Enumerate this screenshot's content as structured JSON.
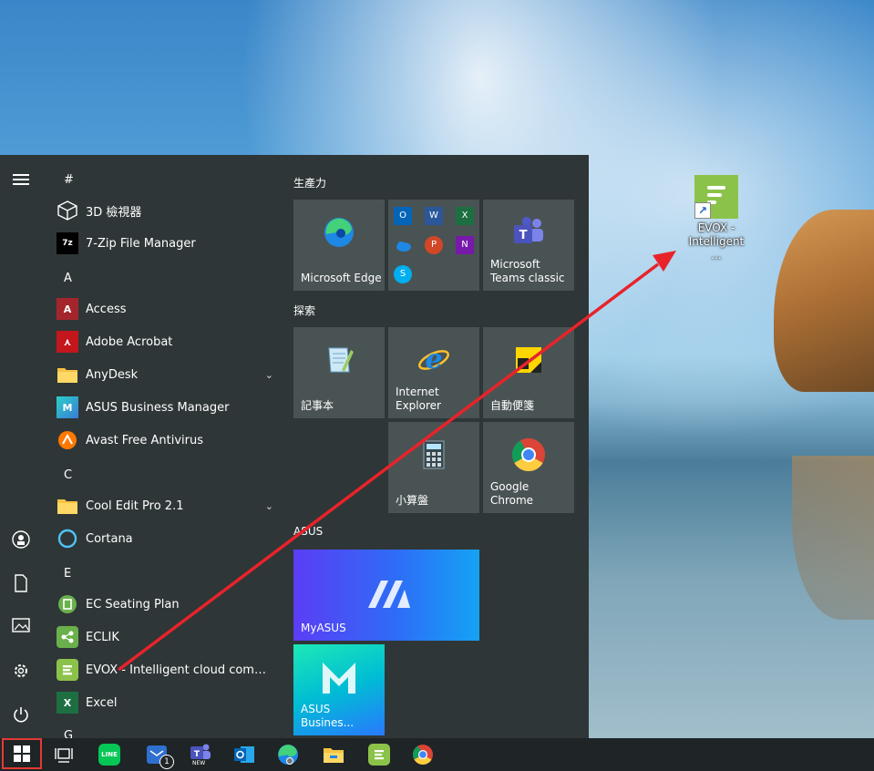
{
  "desktop": {
    "icon": {
      "label_line1": "EVOX -",
      "label_line2": "Intelligent ..."
    }
  },
  "start_menu": {
    "rail_icons": [
      "hamburger-icon",
      "user-icon",
      "document-icon",
      "pictures-icon",
      "settings-icon",
      "power-icon"
    ],
    "letters": {
      "hash": "#",
      "a": "A",
      "c": "C",
      "e": "E",
      "g": "G"
    },
    "apps": {
      "viewer3d": "3D 檢視器",
      "sevenzip": "7-Zip File Manager",
      "access": "Access",
      "acrobat": "Adobe Acrobat",
      "anydesk": "AnyDesk",
      "asus_bm": "ASUS Business Manager",
      "avast": "Avast Free Antivirus",
      "cooledit": "Cool Edit Pro 2.1",
      "cortana": "Cortana",
      "ecseating": "EC Seating Plan",
      "eclik": "ECLIK",
      "evox": "EVOX - Intelligent cloud communic...",
      "excel": "Excel"
    },
    "groups": {
      "productivity": "生產力",
      "explore": "探索",
      "asus": "ASUS"
    },
    "tiles": {
      "edge": "Microsoft Edge",
      "teams_1": "Microsoft",
      "teams_2": "Teams classic",
      "notepad": "記事本",
      "ie_1": "Internet",
      "ie_2": "Explorer",
      "sticky": "自動便箋",
      "calc": "小算盤",
      "chrome": "Google Chrome",
      "myasus": "MyASUS",
      "asus_bm": "ASUS Busines..."
    },
    "office_icons": {
      "outlook": "O",
      "word": "W",
      "excel": "X",
      "powerpoint": "P",
      "onenote": "N",
      "skype": "S"
    }
  },
  "taskbar": {
    "badge_count": "1",
    "line_label": "LINE",
    "teams_new": "NEW"
  },
  "colors": {
    "start_bg": "#2f3637",
    "tile_bg": "#4a5354",
    "accent_red": "#e53935",
    "evox_green": "#8bc34a"
  }
}
